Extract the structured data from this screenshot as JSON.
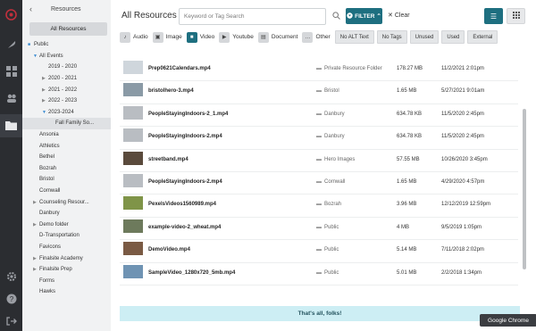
{
  "sidebar": {
    "back_label": "‹",
    "title": "Resources",
    "all_button": "All Resources",
    "tree": [
      {
        "label": "Public",
        "indent": 0,
        "kind": "folder"
      },
      {
        "label": "All Events",
        "indent": 1,
        "kind": "open"
      },
      {
        "label": "2019 - 2020",
        "indent": 2,
        "kind": "none"
      },
      {
        "label": "2020 - 2021",
        "indent": 2,
        "kind": "closed"
      },
      {
        "label": "2021 - 2022",
        "indent": 2,
        "kind": "closed"
      },
      {
        "label": "2022 - 2023",
        "indent": 2,
        "kind": "closed"
      },
      {
        "label": "2023-2024",
        "indent": 2,
        "kind": "open"
      },
      {
        "label": "Fall Family So...",
        "indent": 3,
        "kind": "selected"
      },
      {
        "label": "Ansonia",
        "indent": 1,
        "kind": "none"
      },
      {
        "label": "Athletics",
        "indent": 1,
        "kind": "none"
      },
      {
        "label": "Bethel",
        "indent": 1,
        "kind": "none"
      },
      {
        "label": "Bozrah",
        "indent": 1,
        "kind": "none"
      },
      {
        "label": "Bristol",
        "indent": 1,
        "kind": "none"
      },
      {
        "label": "Cornwall",
        "indent": 1,
        "kind": "none"
      },
      {
        "label": "Counseling Resour...",
        "indent": 1,
        "kind": "closed"
      },
      {
        "label": "Danbury",
        "indent": 1,
        "kind": "none"
      },
      {
        "label": "Demo folder",
        "indent": 1,
        "kind": "closed"
      },
      {
        "label": "D-Transportation",
        "indent": 1,
        "kind": "none"
      },
      {
        "label": "Favicons",
        "indent": 1,
        "kind": "none"
      },
      {
        "label": "Finalsite Academy",
        "indent": 1,
        "kind": "closed"
      },
      {
        "label": "Finalsite Prep",
        "indent": 1,
        "kind": "closed"
      },
      {
        "label": "Forms",
        "indent": 1,
        "kind": "none"
      },
      {
        "label": "Hawks",
        "indent": 1,
        "kind": "none"
      }
    ]
  },
  "header": {
    "title": "All Resources",
    "search_placeholder": "Keyword or Tag Search",
    "filter_label": "FILTER",
    "clear_label": "Clear"
  },
  "filters": {
    "types": [
      {
        "label": "Audio",
        "icon": "audio-icon",
        "active": false
      },
      {
        "label": "Image",
        "icon": "image-icon",
        "active": false
      },
      {
        "label": "Video",
        "icon": "video-icon",
        "active": true
      },
      {
        "label": "Youtube",
        "icon": "youtube-icon",
        "active": false
      },
      {
        "label": "Document",
        "icon": "document-icon",
        "active": false
      },
      {
        "label": "Other",
        "icon": "other-icon",
        "active": false
      }
    ],
    "chips": [
      "No ALT Text",
      "No Tags",
      "Unused",
      "Used",
      "External"
    ]
  },
  "files": [
    {
      "name": "Prep0621Calendars.mp4",
      "folder": "Private Resource Folder",
      "size": "178.27 MB",
      "date": "11/2/2021 2:01pm",
      "thumb": "#cfd6dc"
    },
    {
      "name": "bristolhero-3.mp4",
      "folder": "Bristol",
      "size": "1.65 MB",
      "date": "5/27/2021 9:01am",
      "thumb": "#8a9aa6"
    },
    {
      "name": "PeopleStayingIndoors-2_1.mp4",
      "folder": "Danbury",
      "size": "634.78 KB",
      "date": "11/5/2020 2:45pm",
      "thumb": "#b9bdc2"
    },
    {
      "name": "PeopleStayingIndoors-2.mp4",
      "folder": "Danbury",
      "size": "634.78 KB",
      "date": "11/5/2020 2:45pm",
      "thumb": "#b9bdc2"
    },
    {
      "name": "streetband.mp4",
      "folder": "Hero Images",
      "size": "57.55 MB",
      "date": "10/26/2020 3:45pm",
      "thumb": "#5a4a3c"
    },
    {
      "name": "PeopleStayingIndoors-2.mp4",
      "folder": "Cornwall",
      "size": "1.65 MB",
      "date": "4/29/2020 4:57pm",
      "thumb": "#b9bdc2"
    },
    {
      "name": "PexelsVideos1560989.mp4",
      "folder": "Bozrah",
      "size": "3.96 MB",
      "date": "12/12/2019 12:59pm",
      "thumb": "#7f9448"
    },
    {
      "name": "example-video-2_wheat.mp4",
      "folder": "Public",
      "size": "4 MB",
      "date": "9/5/2019 1:05pm",
      "thumb": "#6d7a5c"
    },
    {
      "name": "DemoVideo.mp4",
      "folder": "Public",
      "size": "5.14 MB",
      "date": "7/11/2018 2:02pm",
      "thumb": "#7a5a44"
    },
    {
      "name": "SampleVideo_1280x720_5mb.mp4",
      "folder": "Public",
      "size": "5.01 MB",
      "date": "2/2/2018 1:34pm",
      "thumb": "#6f93b3"
    }
  ],
  "footer_text": "That's all, folks!",
  "tooltip": "Google Chrome"
}
